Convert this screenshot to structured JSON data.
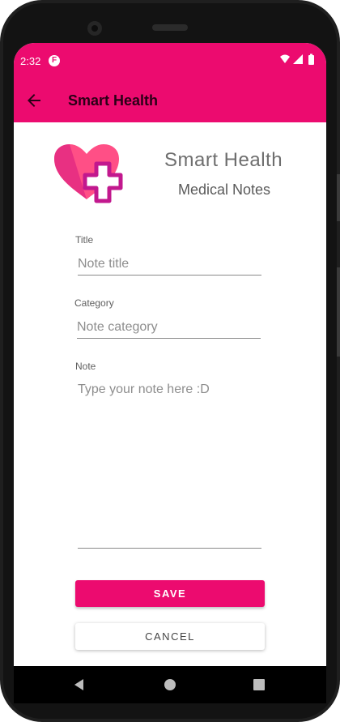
{
  "status_bar": {
    "time": "2:32",
    "app_icon": "F",
    "icons": [
      "wifi-icon",
      "signal-icon",
      "battery-icon"
    ]
  },
  "app_bar": {
    "title": "Smart Health",
    "back_icon": "arrow-back-icon"
  },
  "header": {
    "logo_icon": "heart-plus-icon",
    "title": "Smart Health",
    "subtitle": "Medical Notes"
  },
  "form": {
    "title_label": "Title",
    "title_placeholder": "Note title",
    "category_label": "Category",
    "category_placeholder": "Note category",
    "note_label": "Note",
    "note_placeholder": "Type your note here :D"
  },
  "actions": {
    "save_label": "SAVE",
    "cancel_label": "CANCEL"
  },
  "nav_bar": {
    "icons": [
      "back-triangle-icon",
      "home-circle-icon",
      "recents-square-icon"
    ]
  },
  "colors": {
    "accent": "#ec0b6f",
    "logo_dark": "#c2188e",
    "logo_light": "#ff4f86"
  }
}
